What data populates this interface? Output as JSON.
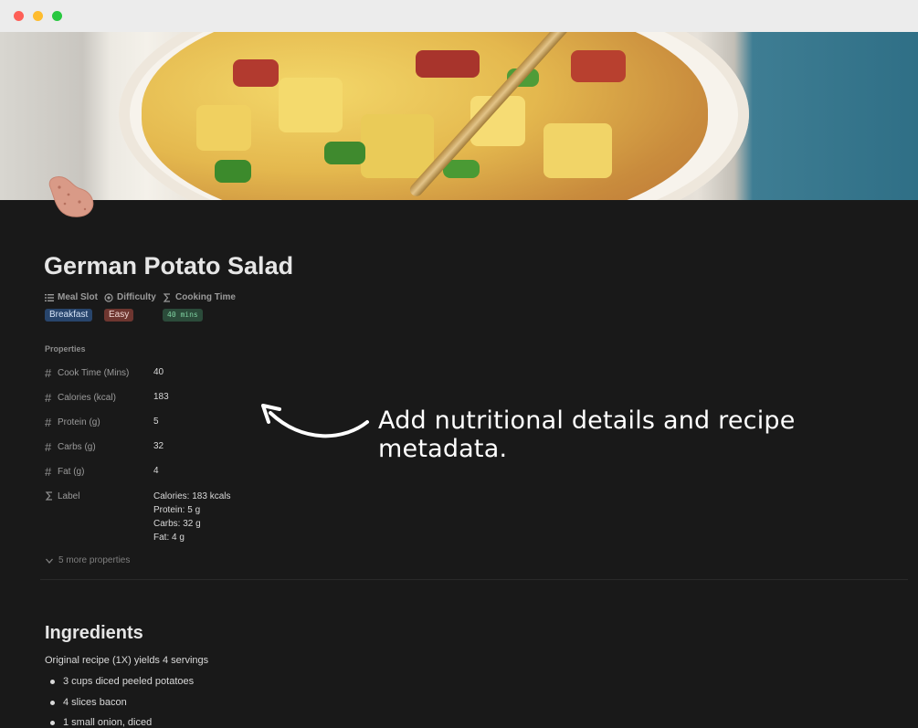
{
  "page": {
    "title": "German Potato Salad"
  },
  "columns": [
    {
      "label": "Meal Slot",
      "icon": "list-icon"
    },
    {
      "label": "Difficulty",
      "icon": "circle-target-icon"
    },
    {
      "label": "Cooking Time",
      "icon": "sigma-icon"
    }
  ],
  "tags": {
    "meal_slot": {
      "text": "Breakfast",
      "bg": "#28456c",
      "fg": "#d6e4f7"
    },
    "difficulty": {
      "text": "Easy",
      "bg": "#6e3630",
      "fg": "#f2d8d4"
    },
    "cooking_time": {
      "text": "40 mins",
      "bg": "#2b4b3a",
      "fg": "#7fd1a1"
    }
  },
  "properties": {
    "heading": "Properties",
    "items": [
      {
        "label": "Cook Time (Mins)",
        "value": "40",
        "icon": "hash-icon"
      },
      {
        "label": "Calories (kcal)",
        "value": "183",
        "icon": "hash-icon"
      },
      {
        "label": "Protein (g)",
        "value": "5",
        "icon": "hash-icon"
      },
      {
        "label": "Carbs (g)",
        "value": "32",
        "icon": "hash-icon"
      },
      {
        "label": "Fat (g)",
        "value": "4",
        "icon": "hash-icon"
      }
    ],
    "label_prop": {
      "label": "Label",
      "icon": "sigma-icon",
      "lines": [
        "Calories: 183 kcals",
        "Protein: 5 g",
        "Carbs: 32 g",
        "Fat: 4 g"
      ]
    },
    "more": "5 more properties"
  },
  "annotation": "Add nutritional details and recipe metadata.",
  "ingredients": {
    "heading": "Ingredients",
    "yield": "Original recipe (1X) yields 4 servings",
    "items": [
      "3 cups diced peeled potatoes",
      "4 slices bacon",
      "1 small onion, diced"
    ]
  }
}
